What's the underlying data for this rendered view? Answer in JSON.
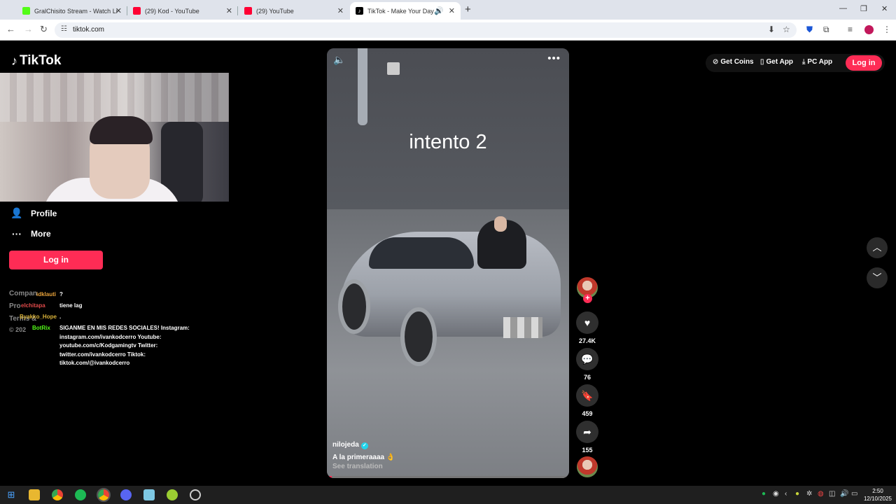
{
  "browser": {
    "tabs": [
      {
        "title": "GralChisito Stream - Watch Liv",
        "favicon": "kick-icon",
        "color": "#53fc18"
      },
      {
        "title": "(29) Kod - YouTube",
        "favicon": "youtube-icon",
        "color": "#ff0033"
      },
      {
        "title": "(29) YouTube",
        "favicon": "youtube-icon",
        "color": "#ff0033"
      },
      {
        "title": "TikTok - Make Your Day",
        "favicon": "tiktok-icon",
        "color": "#000000"
      }
    ],
    "url": "tiktok.com"
  },
  "tiktok": {
    "logo": "TikTok",
    "nav": {
      "profile": "Profile",
      "more": "More"
    },
    "login_side": "Log in",
    "footer": {
      "company": "Compan",
      "program": "Pro",
      "terms": "Terms &",
      "copyright": "© 202"
    },
    "top": {
      "get_coins": "Get Coins",
      "get_app": "Get App",
      "pc_app": "PC App",
      "login": "Log in"
    },
    "video": {
      "overlay_text": "intento 2",
      "author": "nilojeda",
      "caption": "A la primeraaaa 👌",
      "see_translation": "See translation",
      "progress": 0.02
    },
    "actions": {
      "likes": "27.4K",
      "comments": "76",
      "saves": "459",
      "shares": "155"
    }
  },
  "chat": {
    "messages": [
      {
        "user": "idklauti",
        "color": "#e8a23a",
        "text": "?"
      },
      {
        "user": "elchitapa",
        "color": "#e04a4a",
        "text": "tiene lag"
      },
      {
        "user": "Byakko_Hope",
        "color": "#d9b23a",
        "text": "."
      },
      {
        "user": "BotRix",
        "color": "#53fc18",
        "text": "SIGANME EN MIS REDES SOCIALES! Instagram: instagram.com/ivankodcerro Youtube: youtube.com/c/Kodgamingtv Twitter: twitter.com/ivankodcerro Tiktok: tiktok.com/@ivankodcerro"
      }
    ]
  },
  "taskbar": {
    "time": "2:50",
    "date": "12/10/2025"
  }
}
